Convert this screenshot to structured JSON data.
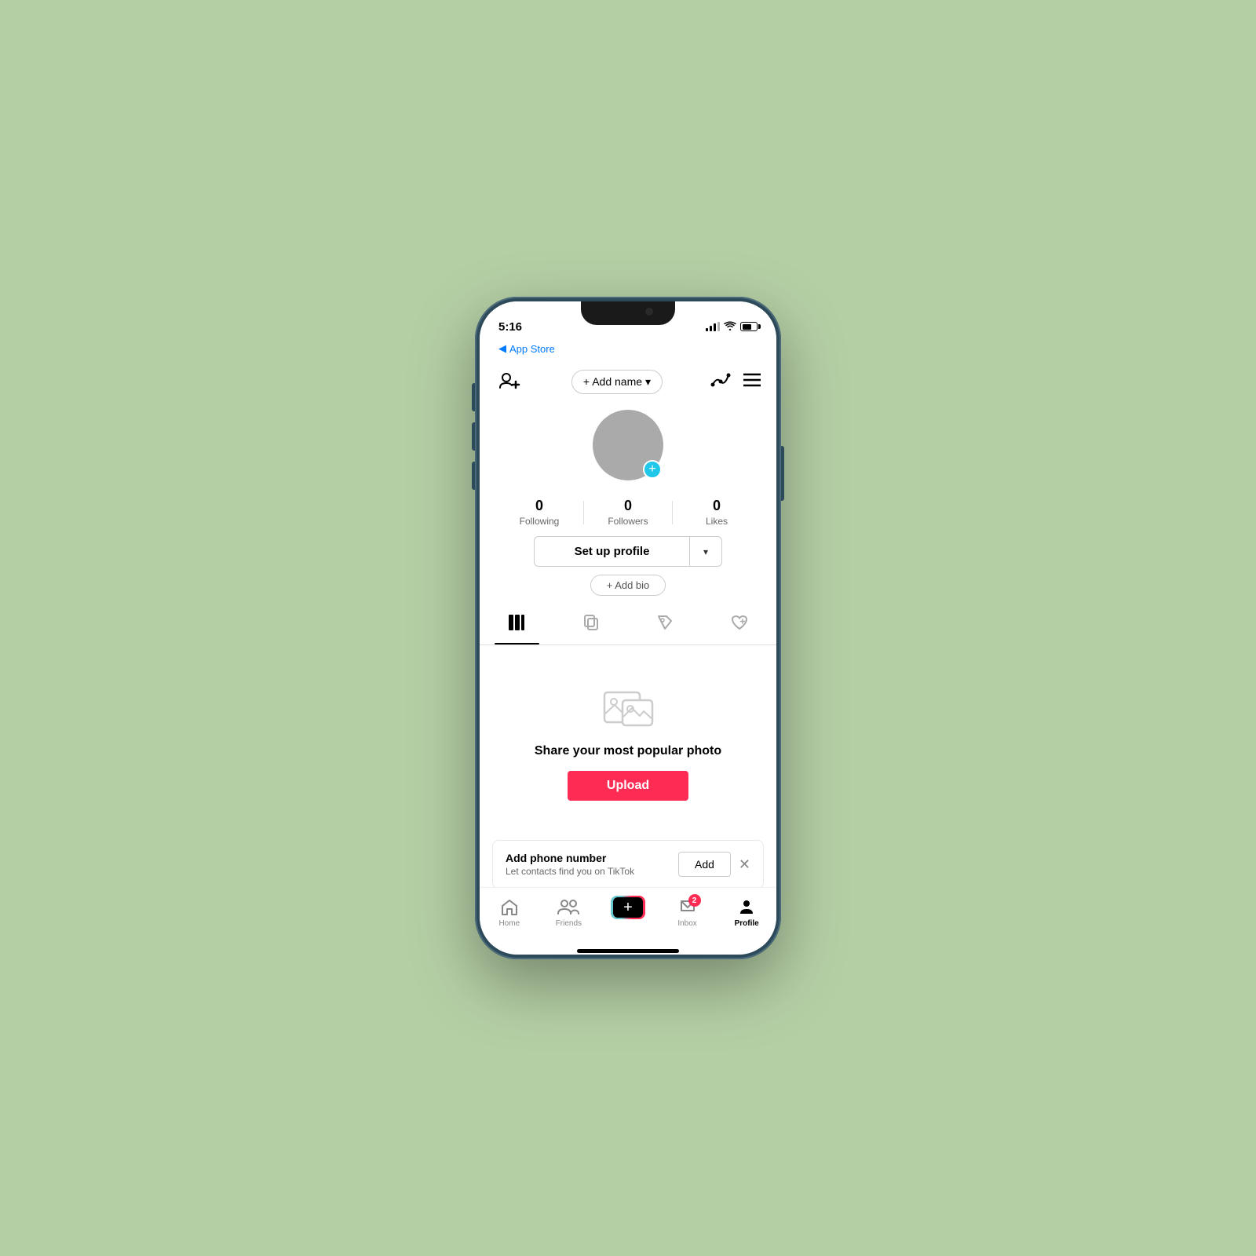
{
  "statusBar": {
    "time": "5:16",
    "backLabel": "App Store"
  },
  "header": {
    "addNameLabel": "+ Add name",
    "menuIcon": "≡"
  },
  "profile": {
    "following": "0",
    "followingLabel": "Following",
    "followers": "0",
    "followersLabel": "Followers",
    "likes": "0",
    "likesLabel": "Likes",
    "setupProfileLabel": "Set up profile",
    "addBioLabel": "+ Add bio"
  },
  "upload": {
    "title": "Share your most popular photo",
    "buttonLabel": "Upload"
  },
  "phoneBanner": {
    "title": "Add phone number",
    "subtitle": "Let contacts find you on TikTok",
    "addLabel": "Add"
  },
  "bottomNav": {
    "homeLabel": "Home",
    "friendsLabel": "Friends",
    "inboxLabel": "Inbox",
    "profileLabel": "Profile",
    "inboxBadge": "2"
  }
}
